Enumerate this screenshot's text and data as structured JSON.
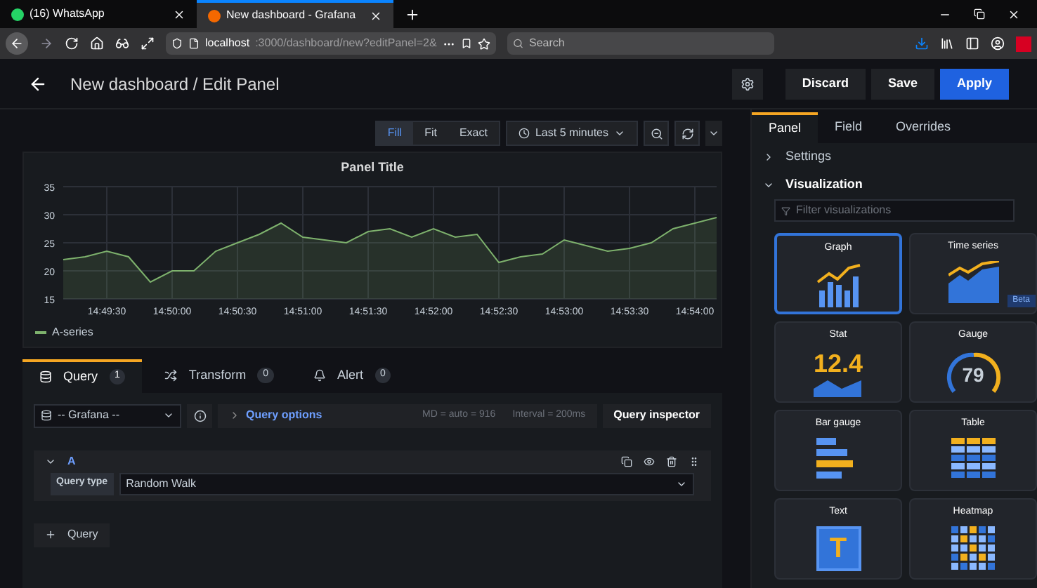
{
  "browser": {
    "tabs": [
      {
        "title": "(16) WhatsApp",
        "selected": false
      },
      {
        "title": "New dashboard - Grafana",
        "selected": true
      }
    ],
    "url_host": "localhost",
    "url_rest": ":3000/dashboard/new?editPanel=2&",
    "search": {
      "placeholder": "Search"
    }
  },
  "header": {
    "title": "New dashboard / Edit Panel",
    "buttons": [
      {
        "label": "Discard",
        "kind": "secondary"
      },
      {
        "label": "Save",
        "kind": "secondary"
      },
      {
        "label": "Apply",
        "kind": "primary"
      }
    ]
  },
  "toolbar": {
    "modes": [
      {
        "label": "Fill",
        "selected": true
      },
      {
        "label": "Fit",
        "selected": false
      },
      {
        "label": "Exact",
        "selected": false
      }
    ],
    "time_range": "Last 5 minutes"
  },
  "panel": {
    "title": "Panel Title",
    "chart_data": {
      "type": "area",
      "categories": [
        null,
        null,
        "14:49:30",
        null,
        null,
        "14:50:00",
        null,
        null,
        "14:50:30",
        null,
        null,
        "14:51:00",
        null,
        null,
        "14:51:30",
        null,
        null,
        "14:52:00",
        null,
        null,
        "14:52:30",
        null,
        null,
        "14:53:00",
        null,
        null,
        "14:53:30",
        null,
        null,
        "14:54:00",
        null
      ],
      "series": [
        {
          "name": "A-series",
          "color": "#7eb26d",
          "values": [
            22,
            22.5,
            23.5,
            22.5,
            18,
            20,
            20,
            23.5,
            25,
            26.5,
            28.5,
            26,
            25.5,
            25,
            27,
            27.5,
            26,
            27.5,
            26,
            26.5,
            21.5,
            22.5,
            23,
            25.5,
            24.5,
            23.5,
            24,
            25,
            27.5,
            28.5,
            29.5
          ]
        }
      ],
      "ylim": [
        15,
        35
      ],
      "yticks": [
        15,
        20,
        25,
        30,
        35
      ],
      "grid": true
    }
  },
  "query_tabs": [
    {
      "label": "Query",
      "count": "1",
      "selected": true
    },
    {
      "label": "Transform",
      "count": "0",
      "selected": false
    },
    {
      "label": "Alert",
      "count": "0",
      "selected": false
    }
  ],
  "query_bar": {
    "datasource": "-- Grafana --",
    "options": "Query options",
    "md": "MD = auto = 916",
    "interval": "Interval = 200ms",
    "inspector": "Query inspector"
  },
  "query": {
    "ref": "A",
    "expanded": true,
    "field_label": "Query type",
    "field_value": "Random Walk"
  },
  "add_query": "Query",
  "editor_tabs": [
    {
      "label": "Panel",
      "selected": true
    },
    {
      "label": "Field",
      "selected": false
    },
    {
      "label": "Overrides",
      "selected": false
    }
  ],
  "sections": [
    {
      "label": "Settings",
      "expanded": false
    },
    {
      "label": "Visualization",
      "expanded": true
    }
  ],
  "filter": {
    "placeholder": "Filter visualizations"
  },
  "visualizations": [
    {
      "name": "Graph",
      "kind": "graph",
      "selected": true
    },
    {
      "name": "Time series",
      "kind": "timeseries",
      "selected": false,
      "badge": "Beta"
    },
    {
      "name": "Stat",
      "kind": "stat",
      "selected": false,
      "value": "12.4"
    },
    {
      "name": "Gauge",
      "kind": "gauge",
      "selected": false,
      "value": "79"
    },
    {
      "name": "Bar gauge",
      "kind": "bargauge",
      "selected": false
    },
    {
      "name": "Table",
      "kind": "table",
      "selected": false
    },
    {
      "name": "Text",
      "kind": "text",
      "selected": false,
      "value": "T"
    },
    {
      "name": "Heatmap",
      "kind": "heatmap",
      "selected": false
    }
  ]
}
